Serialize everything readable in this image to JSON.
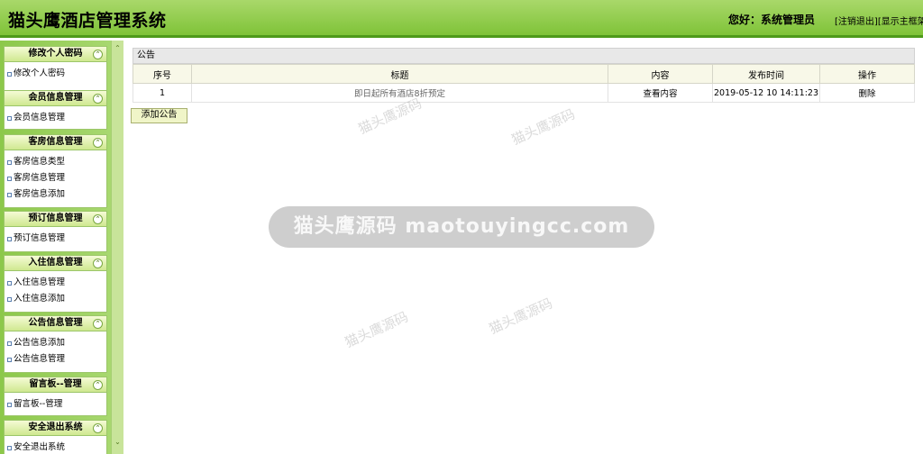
{
  "header": {
    "title": "猫头鹰酒店管理系统",
    "welcome": "您好：系统管理员",
    "logout_link": "[注销退出]",
    "show_frame_link": "[显示主框架]"
  },
  "sidebar": {
    "sections": [
      {
        "title": "修改个人密码",
        "items": [
          "修改个人密码"
        ]
      },
      {
        "title": "会员信息管理",
        "items": [
          "会员信息管理"
        ]
      },
      {
        "title": "客房信息管理",
        "items": [
          "客房信息类型",
          "客房信息管理",
          "客房信息添加"
        ]
      },
      {
        "title": "预订信息管理",
        "items": [
          "预订信息管理"
        ]
      },
      {
        "title": "入住信息管理",
        "items": [
          "入住信息管理",
          "入住信息添加"
        ]
      },
      {
        "title": "公告信息管理",
        "items": [
          "公告信息添加",
          "公告信息管理"
        ]
      },
      {
        "title": "留言板--管理",
        "items": [
          "留言板--管理"
        ]
      },
      {
        "title": "安全退出系统",
        "items": [
          "安全退出系统"
        ]
      }
    ]
  },
  "main": {
    "panel_title": "公告",
    "columns": [
      "序号",
      "标题",
      "内容",
      "发布时间",
      "操作"
    ],
    "rows": [
      {
        "id": "1",
        "title": "即日起所有酒店8折预定",
        "content": "查看内容",
        "time": "2019-05-12 10 14:11:23",
        "action": "删除"
      }
    ],
    "add_button": "添加公告"
  },
  "watermark": {
    "center": "猫头鹰源码 maotouyingcc.com",
    "small_cn": "猫头鹰源码",
    "small_en": "maotouyingcc.com"
  }
}
